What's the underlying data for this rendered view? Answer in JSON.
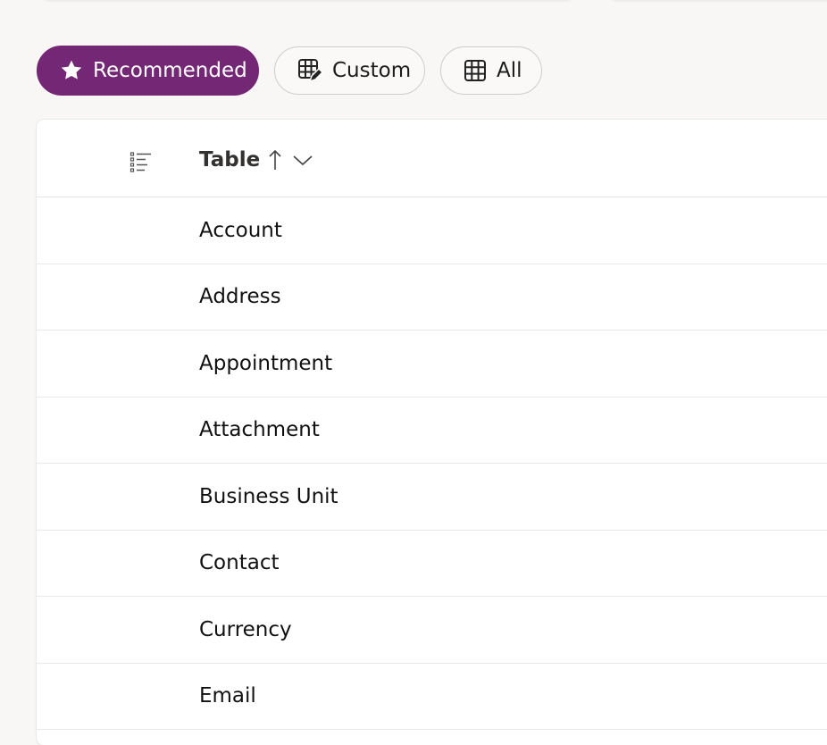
{
  "filters": {
    "recommended": "Recommended",
    "custom": "Custom",
    "all": "All"
  },
  "colors": {
    "accent": "#742774",
    "page_background": "#f8f7f6",
    "card_background": "#ffffff"
  },
  "table": {
    "column_header": "Table",
    "sort_direction": "ascending",
    "rows": [
      "Account",
      "Address",
      "Appointment",
      "Attachment",
      "Business Unit",
      "Contact",
      "Currency",
      "Email"
    ]
  }
}
